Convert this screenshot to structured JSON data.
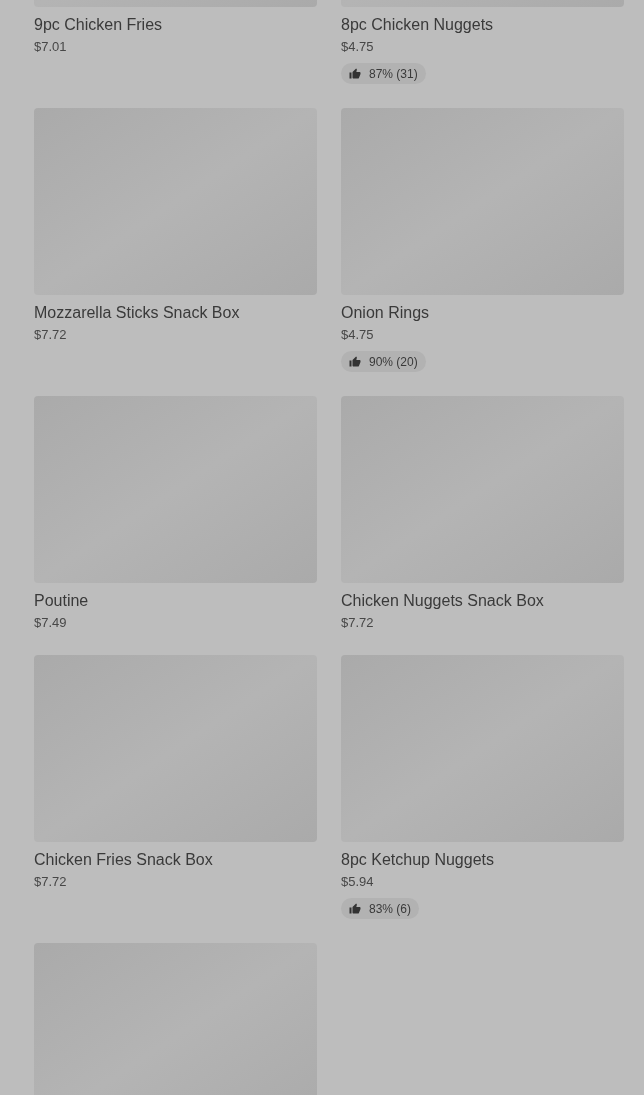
{
  "items": [
    {
      "kind": "product",
      "name": "9pc Chicken Fries",
      "price": "$7.01"
    },
    {
      "kind": "product",
      "name": "8pc Chicken Nuggets",
      "price": "$4.75",
      "rating": "87% (31)"
    },
    {
      "kind": "product",
      "name": "Mozzarella Sticks Snack Box",
      "price": "$7.72"
    },
    {
      "kind": "product",
      "name": "Onion Rings",
      "price": "$4.75",
      "rating": "90% (20)"
    },
    {
      "kind": "product",
      "name": "Poutine",
      "price": "$7.49"
    },
    {
      "kind": "product",
      "name": "Chicken Nuggets Snack Box",
      "price": "$7.72"
    },
    {
      "kind": "product",
      "name": "Chicken Fries Snack Box",
      "price": "$7.72"
    },
    {
      "kind": "product",
      "name": "8pc Ketchup Nuggets",
      "price": "$5.94",
      "rating": "83% (6)"
    },
    {
      "kind": "image-only"
    }
  ]
}
